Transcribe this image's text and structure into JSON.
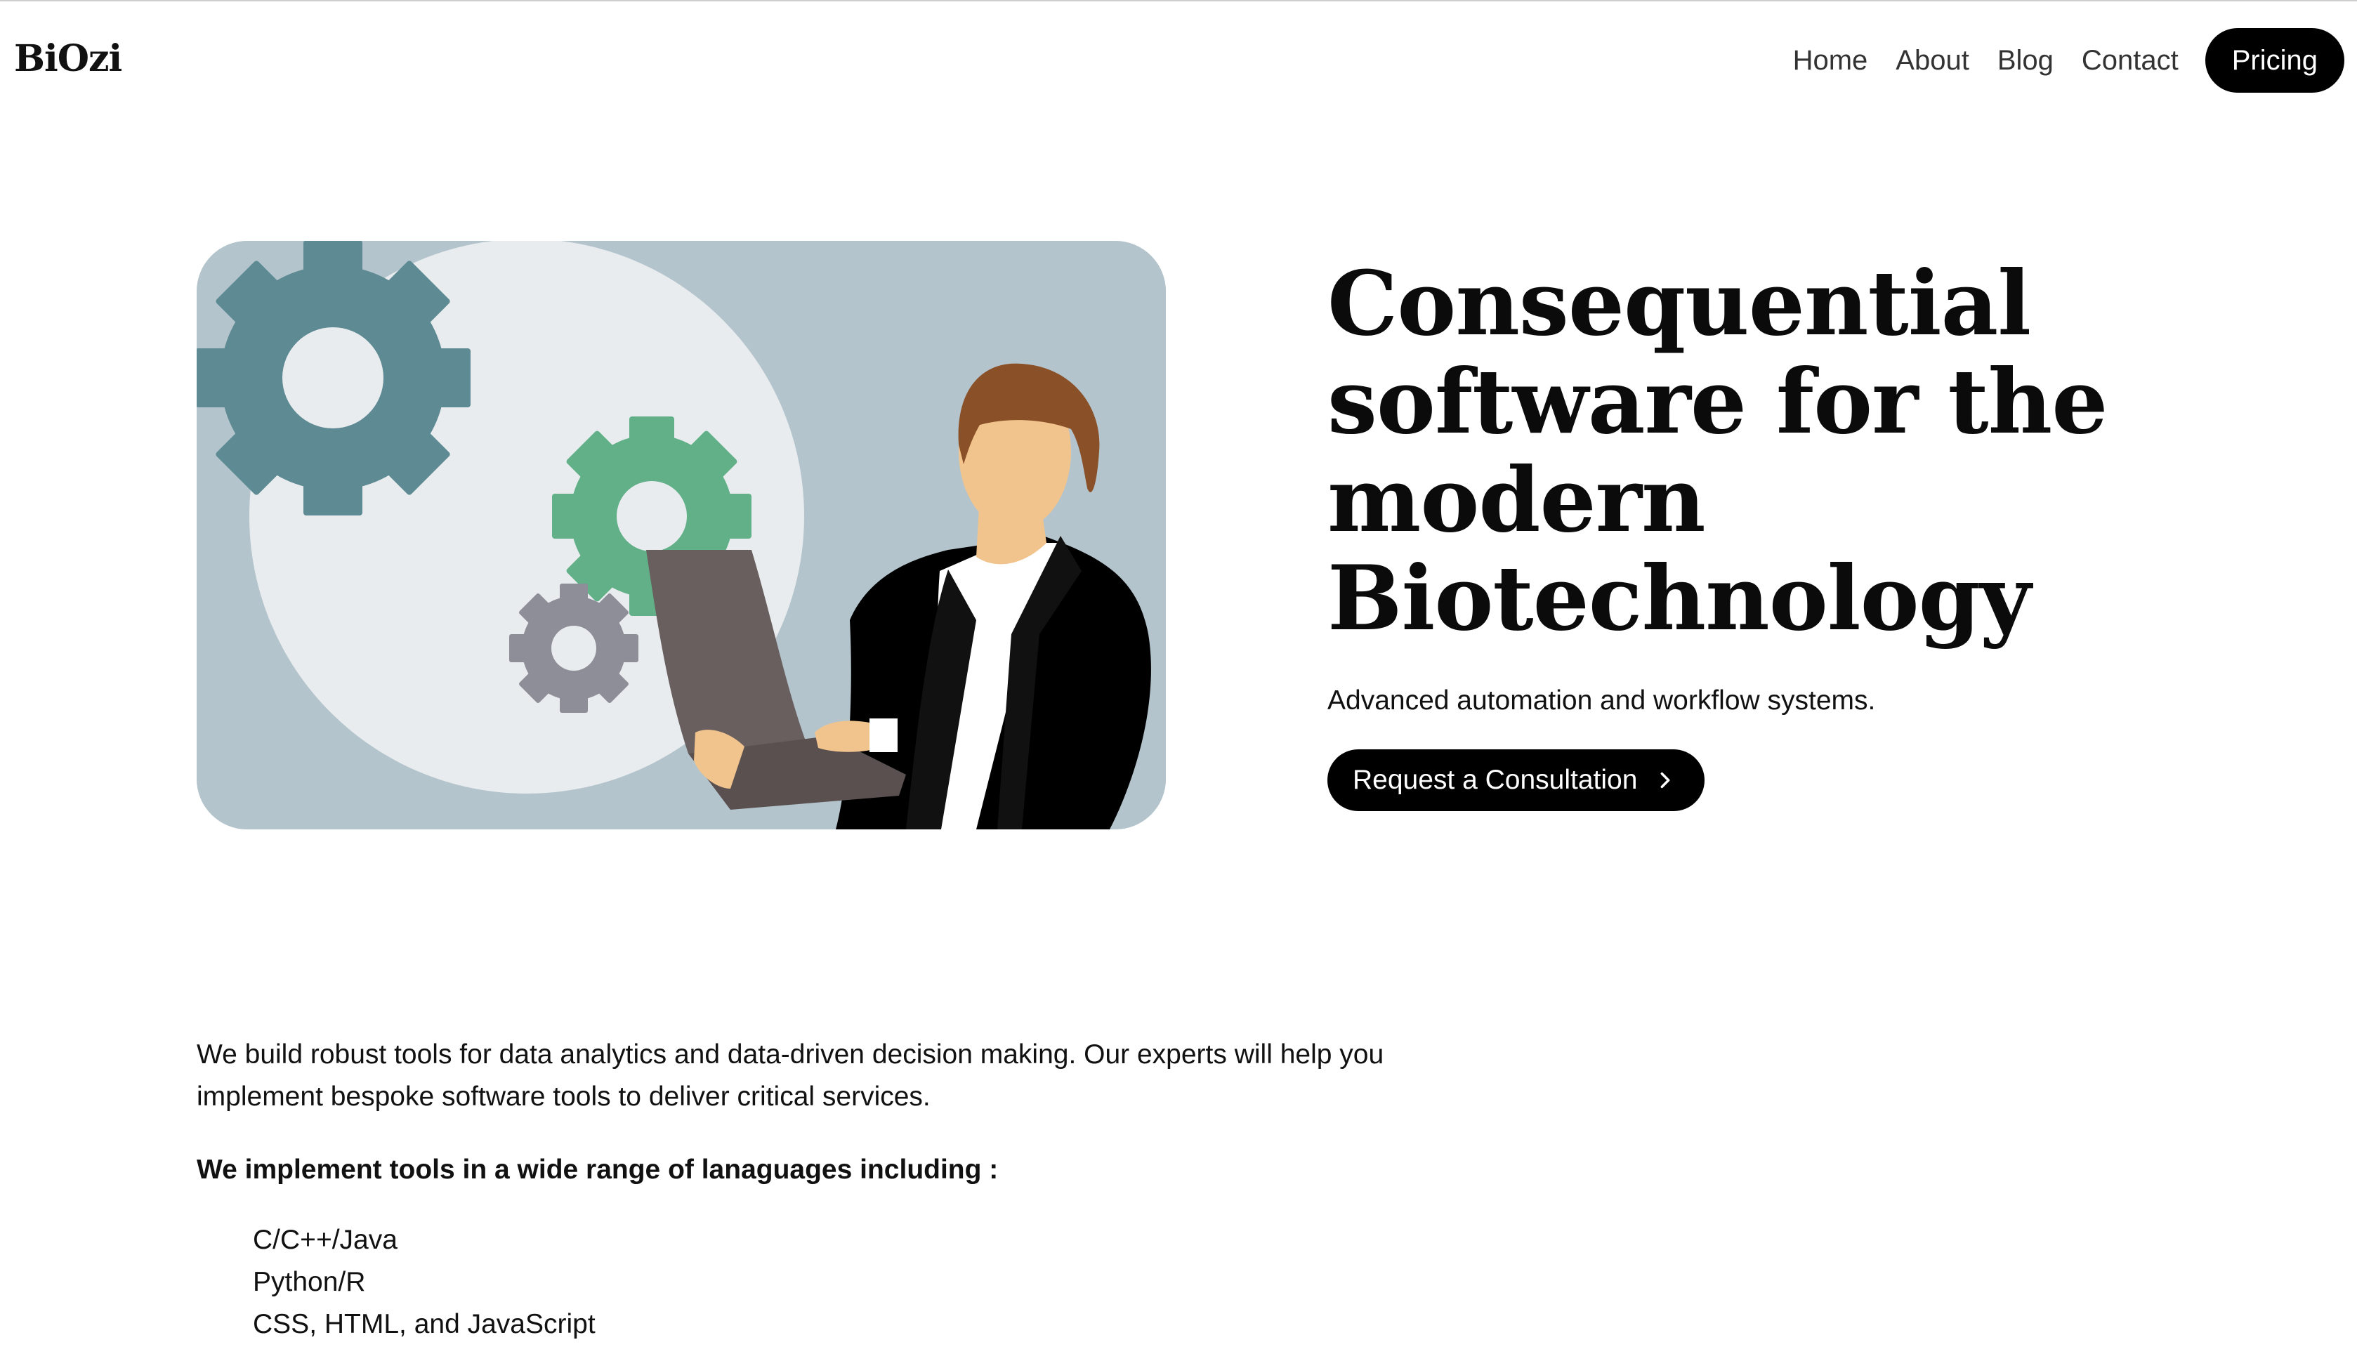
{
  "brand": {
    "name": "BiOzi"
  },
  "nav": {
    "links": [
      "Home",
      "About",
      "Blog",
      "Contact"
    ],
    "cta": "Pricing"
  },
  "hero": {
    "image_icon": "illustration-woman-laptop-gears",
    "title": "Consequential software for the modern Biotechnology",
    "subtitle": "Advanced automation and workflow systems.",
    "button_label": "Request a Consultation",
    "button_icon": "chevron-right-icon"
  },
  "intro": {
    "paragraph": "We build robust tools for data analytics and data-driven decision making. Our experts will help you implement bespoke software tools to deliver critical services.",
    "languages_heading": "We implement tools in a wide range of lanaguages including :",
    "languages": [
      "C/C++/Java",
      "Python/R",
      "CSS, HTML, and JavaScript"
    ]
  },
  "colors": {
    "accent": "#000000",
    "illustration_bg": "#b4c4cc",
    "gear_teal": "#5e8a93",
    "gear_green": "#62b088",
    "gear_gray": "#8e8e99"
  }
}
